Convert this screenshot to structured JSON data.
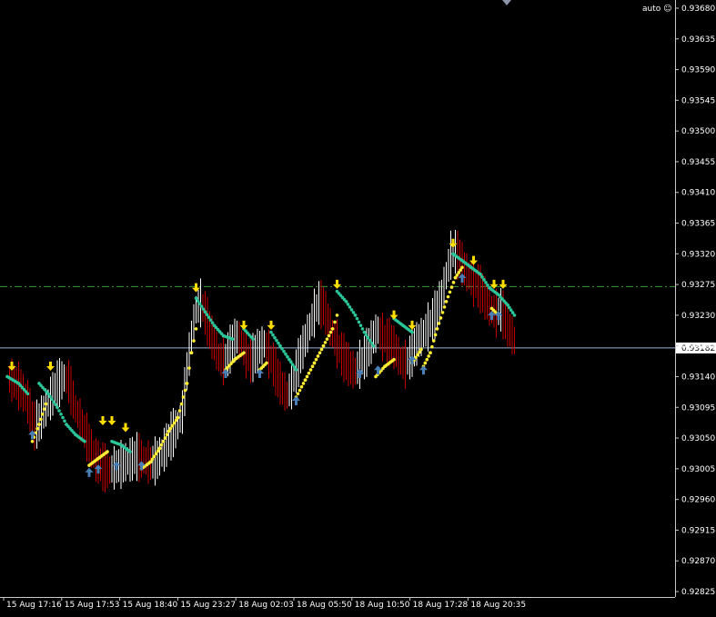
{
  "app": {
    "mode_label": "auto",
    "mode_icon": "smiley-icon"
  },
  "colors": {
    "background": "#000000",
    "frame": "#c8c8c8",
    "bar_up": "#ffffff",
    "bar_down": "#c80000",
    "trail_down": "#2bc59a",
    "trail_up": "#ffee33",
    "arrow_sell": "#ffdd00",
    "arrow_buy": "#4a7fb5",
    "level_line": "#3c9a3c",
    "bid_line": "#9cb4d8",
    "text": "#ffffff"
  },
  "chart_data": {
    "type": "candlestick-line",
    "y_ticks": [
      "0.93680",
      "0.93635",
      "0.93590",
      "0.93545",
      "0.93500",
      "0.93455",
      "0.93410",
      "0.93365",
      "0.93320",
      "0.93275",
      "0.93230",
      "0.93185",
      "0.93140",
      "0.93095",
      "0.93050",
      "0.93005",
      "0.92960",
      "0.92915",
      "0.92870",
      "0.92825"
    ],
    "ylim": [
      0.92825,
      0.9368
    ],
    "x_labels": [
      "15 Aug 17:16",
      "15 Aug 17:53",
      "15 Aug 18:40",
      "15 Aug 23:27",
      "18 Aug 02:03",
      "18 Aug 05:50",
      "18 Aug 10:50",
      "18 Aug 17:28",
      "18 Aug 20:35"
    ],
    "current_price": {
      "label": "0.93182",
      "value": 0.93182
    },
    "level_line": {
      "value": 0.93272,
      "style": "dash-dot"
    },
    "close_path": [
      [
        0,
        0.9314
      ],
      [
        3,
        0.93135
      ],
      [
        6,
        0.93125
      ],
      [
        9,
        0.93105
      ],
      [
        12,
        0.9307
      ],
      [
        14,
        0.93075
      ],
      [
        16,
        0.9309
      ],
      [
        19,
        0.9311
      ],
      [
        22,
        0.9313
      ],
      [
        25,
        0.9314
      ],
      [
        27,
        0.93135
      ],
      [
        30,
        0.93095
      ],
      [
        33,
        0.9307
      ],
      [
        36,
        0.93045
      ],
      [
        39,
        0.9302
      ],
      [
        42,
        0.9301
      ],
      [
        45,
        0.93005
      ],
      [
        48,
        0.9301
      ],
      [
        51,
        0.93015
      ],
      [
        54,
        0.9302
      ],
      [
        57,
        0.93025
      ],
      [
        60,
        0.9302
      ],
      [
        63,
        0.93015
      ],
      [
        66,
        0.9302
      ],
      [
        69,
        0.93035
      ],
      [
        72,
        0.93055
      ],
      [
        75,
        0.9307
      ],
      [
        77,
        0.9309
      ],
      [
        79,
        0.9315
      ],
      [
        81,
        0.932
      ],
      [
        83,
        0.9324
      ],
      [
        85,
        0.9325
      ],
      [
        87,
        0.93235
      ],
      [
        89,
        0.9321
      ],
      [
        91,
        0.9319
      ],
      [
        93,
        0.9317
      ],
      [
        95,
        0.93165
      ],
      [
        97,
        0.93175
      ],
      [
        99,
        0.9319
      ],
      [
        101,
        0.932
      ],
      [
        103,
        0.9319
      ],
      [
        105,
        0.93175
      ],
      [
        107,
        0.93165
      ],
      [
        109,
        0.93175
      ],
      [
        111,
        0.93185
      ],
      [
        113,
        0.9319
      ],
      [
        115,
        0.93175
      ],
      [
        117,
        0.9316
      ],
      [
        119,
        0.9314
      ],
      [
        121,
        0.93125
      ],
      [
        123,
        0.93115
      ],
      [
        125,
        0.9313
      ],
      [
        127,
        0.9315
      ],
      [
        129,
        0.93175
      ],
      [
        131,
        0.93195
      ],
      [
        133,
        0.93215
      ],
      [
        135,
        0.93235
      ],
      [
        137,
        0.9325
      ],
      [
        139,
        0.93245
      ],
      [
        141,
        0.93225
      ],
      [
        143,
        0.93205
      ],
      [
        145,
        0.9319
      ],
      [
        147,
        0.93175
      ],
      [
        149,
        0.93165
      ],
      [
        151,
        0.93155
      ],
      [
        153,
        0.9315
      ],
      [
        155,
        0.9316
      ],
      [
        157,
        0.9317
      ],
      [
        159,
        0.93185
      ],
      [
        161,
        0.932
      ],
      [
        163,
        0.9321
      ],
      [
        165,
        0.932
      ],
      [
        167,
        0.93195
      ],
      [
        169,
        0.9319
      ],
      [
        171,
        0.9318
      ],
      [
        173,
        0.93165
      ],
      [
        175,
        0.9316
      ],
      [
        177,
        0.9317
      ],
      [
        179,
        0.93185
      ],
      [
        181,
        0.93195
      ],
      [
        183,
        0.93205
      ],
      [
        185,
        0.93215
      ],
      [
        187,
        0.93225
      ],
      [
        189,
        0.9324
      ],
      [
        191,
        0.9326
      ],
      [
        193,
        0.9329
      ],
      [
        195,
        0.9332
      ],
      [
        197,
        0.93325
      ],
      [
        199,
        0.93315
      ],
      [
        201,
        0.933
      ],
      [
        203,
        0.9329
      ],
      [
        205,
        0.9328
      ],
      [
        207,
        0.93275
      ],
      [
        209,
        0.93265
      ],
      [
        211,
        0.9325
      ],
      [
        213,
        0.9324
      ],
      [
        215,
        0.93235
      ],
      [
        217,
        0.9324
      ],
      [
        219,
        0.93225
      ],
      [
        221,
        0.9321
      ],
      [
        223,
        0.93195
      ]
    ],
    "trail_down_segments": [
      [
        [
          0,
          0.9314
        ],
        [
          5,
          0.9313
        ],
        [
          9,
          0.93115
        ]
      ],
      [
        [
          14,
          0.9313
        ],
        [
          18,
          0.93115
        ],
        [
          22,
          0.93095
        ],
        [
          26,
          0.9307
        ],
        [
          30,
          0.93055
        ],
        [
          34,
          0.93045
        ]
      ],
      [
        [
          46,
          0.93045
        ],
        [
          50,
          0.9304
        ],
        [
          54,
          0.9303
        ]
      ],
      [
        [
          83,
          0.93255
        ],
        [
          87,
          0.93235
        ],
        [
          91,
          0.93215
        ],
        [
          95,
          0.932
        ],
        [
          99,
          0.93195
        ]
      ],
      [
        [
          104,
          0.9321
        ],
        [
          108,
          0.93195
        ]
      ],
      [
        [
          116,
          0.93205
        ],
        [
          120,
          0.93185
        ],
        [
          124,
          0.93165
        ],
        [
          127,
          0.9315
        ]
      ],
      [
        [
          145,
          0.93265
        ],
        [
          149,
          0.9325
        ],
        [
          153,
          0.9323
        ],
        [
          157,
          0.93205
        ],
        [
          161,
          0.93185
        ]
      ],
      [
        [
          170,
          0.93225
        ],
        [
          174,
          0.93215
        ],
        [
          178,
          0.93205
        ]
      ],
      [
        [
          196,
          0.9332
        ],
        [
          200,
          0.9331
        ],
        [
          204,
          0.933
        ],
        [
          208,
          0.9329
        ],
        [
          212,
          0.9327
        ],
        [
          216,
          0.9326
        ],
        [
          220,
          0.93245
        ],
        [
          223,
          0.9323
        ]
      ]
    ],
    "trail_up_segments": [
      [
        [
          11,
          0.93045
        ],
        [
          14,
          0.9307
        ],
        [
          17,
          0.931
        ]
      ],
      [
        [
          36,
          0.9301
        ],
        [
          40,
          0.9302
        ],
        [
          44,
          0.9303
        ]
      ],
      [
        [
          59,
          0.93005
        ],
        [
          63,
          0.93015
        ],
        [
          67,
          0.93035
        ],
        [
          71,
          0.9306
        ],
        [
          75,
          0.9308
        ],
        [
          79,
          0.9313
        ],
        [
          81,
          0.93175
        ],
        [
          83,
          0.9321
        ]
      ],
      [
        [
          96,
          0.9315
        ],
        [
          100,
          0.93165
        ],
        [
          104,
          0.93175
        ]
      ],
      [
        [
          111,
          0.9315
        ],
        [
          114,
          0.9316
        ]
      ],
      [
        [
          127,
          0.9311
        ],
        [
          131,
          0.93135
        ],
        [
          135,
          0.9316
        ],
        [
          139,
          0.93185
        ],
        [
          143,
          0.9321
        ],
        [
          145,
          0.9323
        ]
      ],
      [
        [
          162,
          0.9314
        ],
        [
          166,
          0.93155
        ],
        [
          170,
          0.93165
        ]
      ],
      [
        [
          178,
          0.9316
        ],
        [
          182,
          0.9318
        ]
      ],
      [
        [
          183,
          0.93155
        ],
        [
          186,
          0.93175
        ],
        [
          189,
          0.9321
        ],
        [
          193,
          0.9325
        ],
        [
          197,
          0.93285
        ],
        [
          200,
          0.933
        ]
      ],
      [
        [
          213,
          0.9324
        ],
        [
          216,
          0.9323
        ]
      ]
    ],
    "sell_arrows": [
      [
        2,
        0.9315
      ],
      [
        19,
        0.9315
      ],
      [
        42,
        0.9307
      ],
      [
        46,
        0.9307
      ],
      [
        52,
        0.9306
      ],
      [
        83,
        0.93265
      ],
      [
        104,
        0.9321
      ],
      [
        116,
        0.9321
      ],
      [
        145,
        0.9327
      ],
      [
        170,
        0.93225
      ],
      [
        178,
        0.9321
      ],
      [
        196,
        0.9333
      ],
      [
        205,
        0.93305
      ],
      [
        214,
        0.9327
      ],
      [
        218,
        0.9327
      ]
    ],
    "buy_arrows": [
      [
        11,
        0.9306
      ],
      [
        36,
        0.93005
      ],
      [
        40,
        0.9301
      ],
      [
        48,
        0.93015
      ],
      [
        59,
        0.93015
      ],
      [
        96,
        0.9315
      ],
      [
        111,
        0.9315
      ],
      [
        127,
        0.9311
      ],
      [
        155,
        0.9315
      ],
      [
        163,
        0.93155
      ],
      [
        178,
        0.9317
      ],
      [
        183,
        0.93155
      ],
      [
        200,
        0.9329
      ],
      [
        213,
        0.93235
      ],
      [
        216,
        0.93235
      ]
    ]
  }
}
